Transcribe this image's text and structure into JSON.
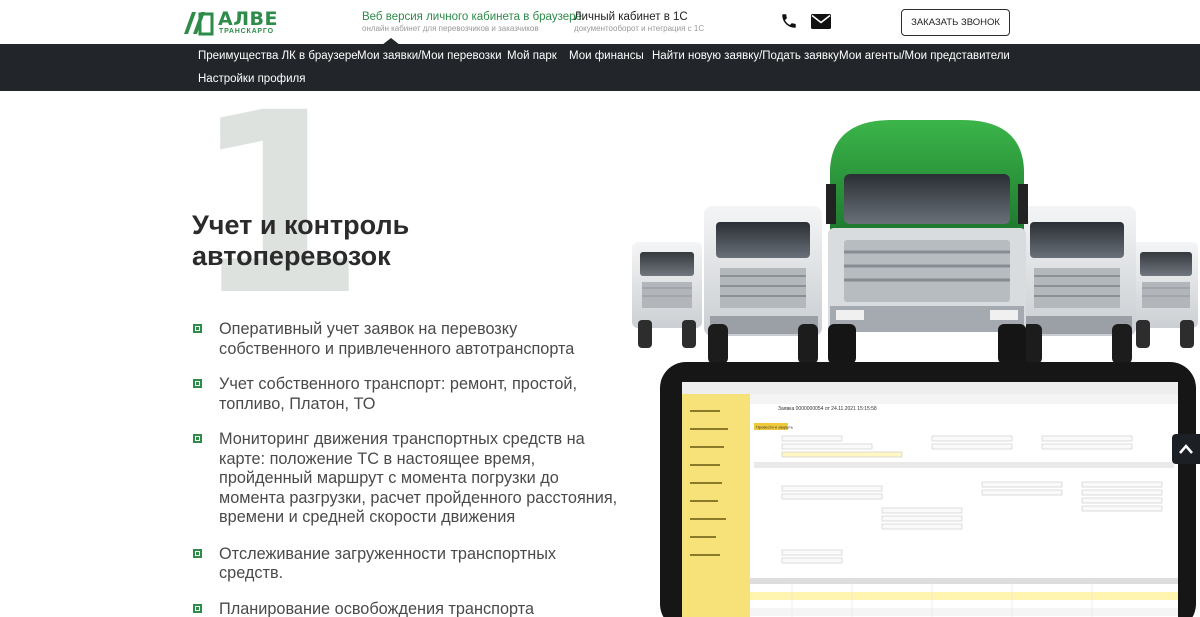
{
  "brand": {
    "name": "АЛВЕ",
    "sub": "ТРАНСКАРГО",
    "color": "#2e8b4a"
  },
  "header": {
    "links": [
      {
        "title": "Веб версия личного кабинета в браузере",
        "subtitle": "онлайн кабинет для перевозчиков и заказчиков",
        "active": true
      },
      {
        "title": "Личный кабинет в 1С",
        "subtitle": "документооборот и нтеграция с 1С",
        "active": false
      }
    ],
    "icons": [
      "phone-icon",
      "mail-icon"
    ],
    "call_button": "ЗАКАЗАТЬ ЗВОНОК"
  },
  "nav": {
    "items": [
      "Преимущества ЛК в браузере",
      "Мои заявки/Мои перевозки",
      "Мой парк",
      "Мои финансы",
      "Найти новую заявку/Подать заявку",
      "Мои агенты/Мои представители",
      "Настройки профиля"
    ]
  },
  "content": {
    "number": "1",
    "title": "Учет и контроль автоперевозок",
    "features": [
      "Оперативный учет заявок на перевозку собственного и привлеченного автотранспорта",
      "Учет собственного транспорт: ремонт, простой, топливо, Платон, ТО",
      "Мониторинг движения транспортных средств на карте: положение ТС в настоящее время, пройденный маршрут с момента погрузки до момента разгрузки, расчет пройденного расстояния, времени и средней скорости движения",
      "Отслеживание загруженности транспортных средств.",
      "Планирование освобождения транспорта"
    ]
  },
  "illustration": {
    "tablet_window_title": "Заявка 0000000054 от 24.11.2021 15:15:58",
    "tablet_toolbar_button": "Провести и закрыть"
  }
}
